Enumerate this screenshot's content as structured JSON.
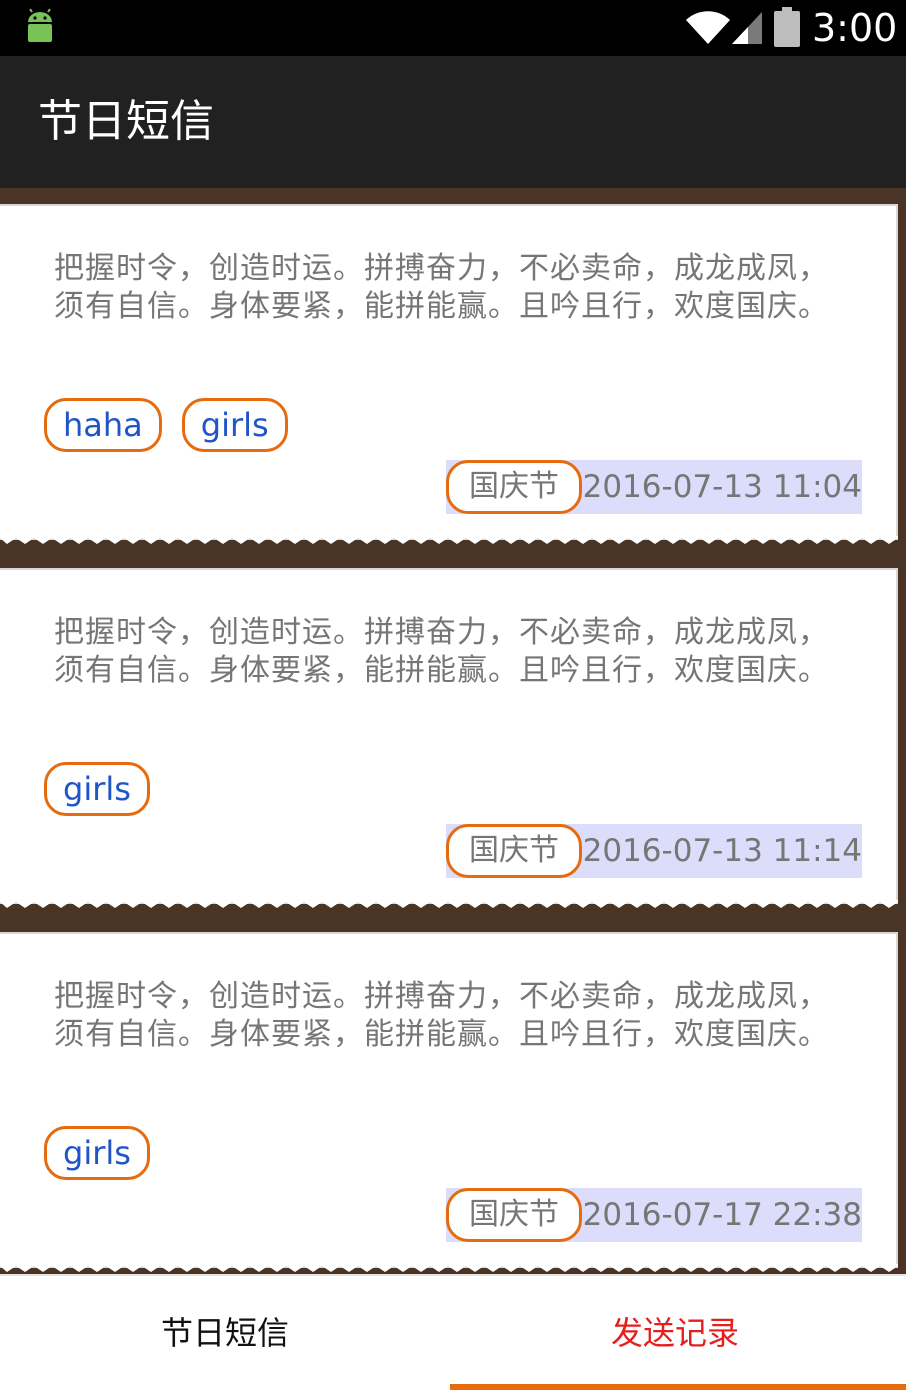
{
  "status_bar": {
    "time": "3:00"
  },
  "app_bar": {
    "title": "节日短信"
  },
  "messages": [
    {
      "text": "把握时令，创造时运。拼搏奋力，不必卖命，成龙成凤，须有自信。身体要紧，能拼能赢。且吟且行，欢度国庆。",
      "tags": [
        "haha",
        "girls"
      ],
      "category": "国庆节",
      "datetime": "2016-07-13 11:04"
    },
    {
      "text": "把握时令，创造时运。拼搏奋力，不必卖命，成龙成凤，须有自信。身体要紧，能拼能赢。且吟且行，欢度国庆。",
      "tags": [
        "girls"
      ],
      "category": "国庆节",
      "datetime": "2016-07-13 11:14"
    },
    {
      "text": "把握时令，创造时运。拼搏奋力，不必卖命，成龙成凤，须有自信。身体要紧，能拼能赢。且吟且行，欢度国庆。",
      "tags": [
        "girls"
      ],
      "category": "国庆节",
      "datetime": "2016-07-17 22:38"
    }
  ],
  "tabs": [
    {
      "label": "节日短信",
      "selected": false
    },
    {
      "label": "发送记录",
      "selected": true
    }
  ],
  "colors": {
    "accent": "#e66b0f",
    "tag_text": "#1f55c9",
    "selected_tab_text": "#e51e1e",
    "list_background": "#4a3426",
    "date_highlight": "#dcdcfb"
  }
}
